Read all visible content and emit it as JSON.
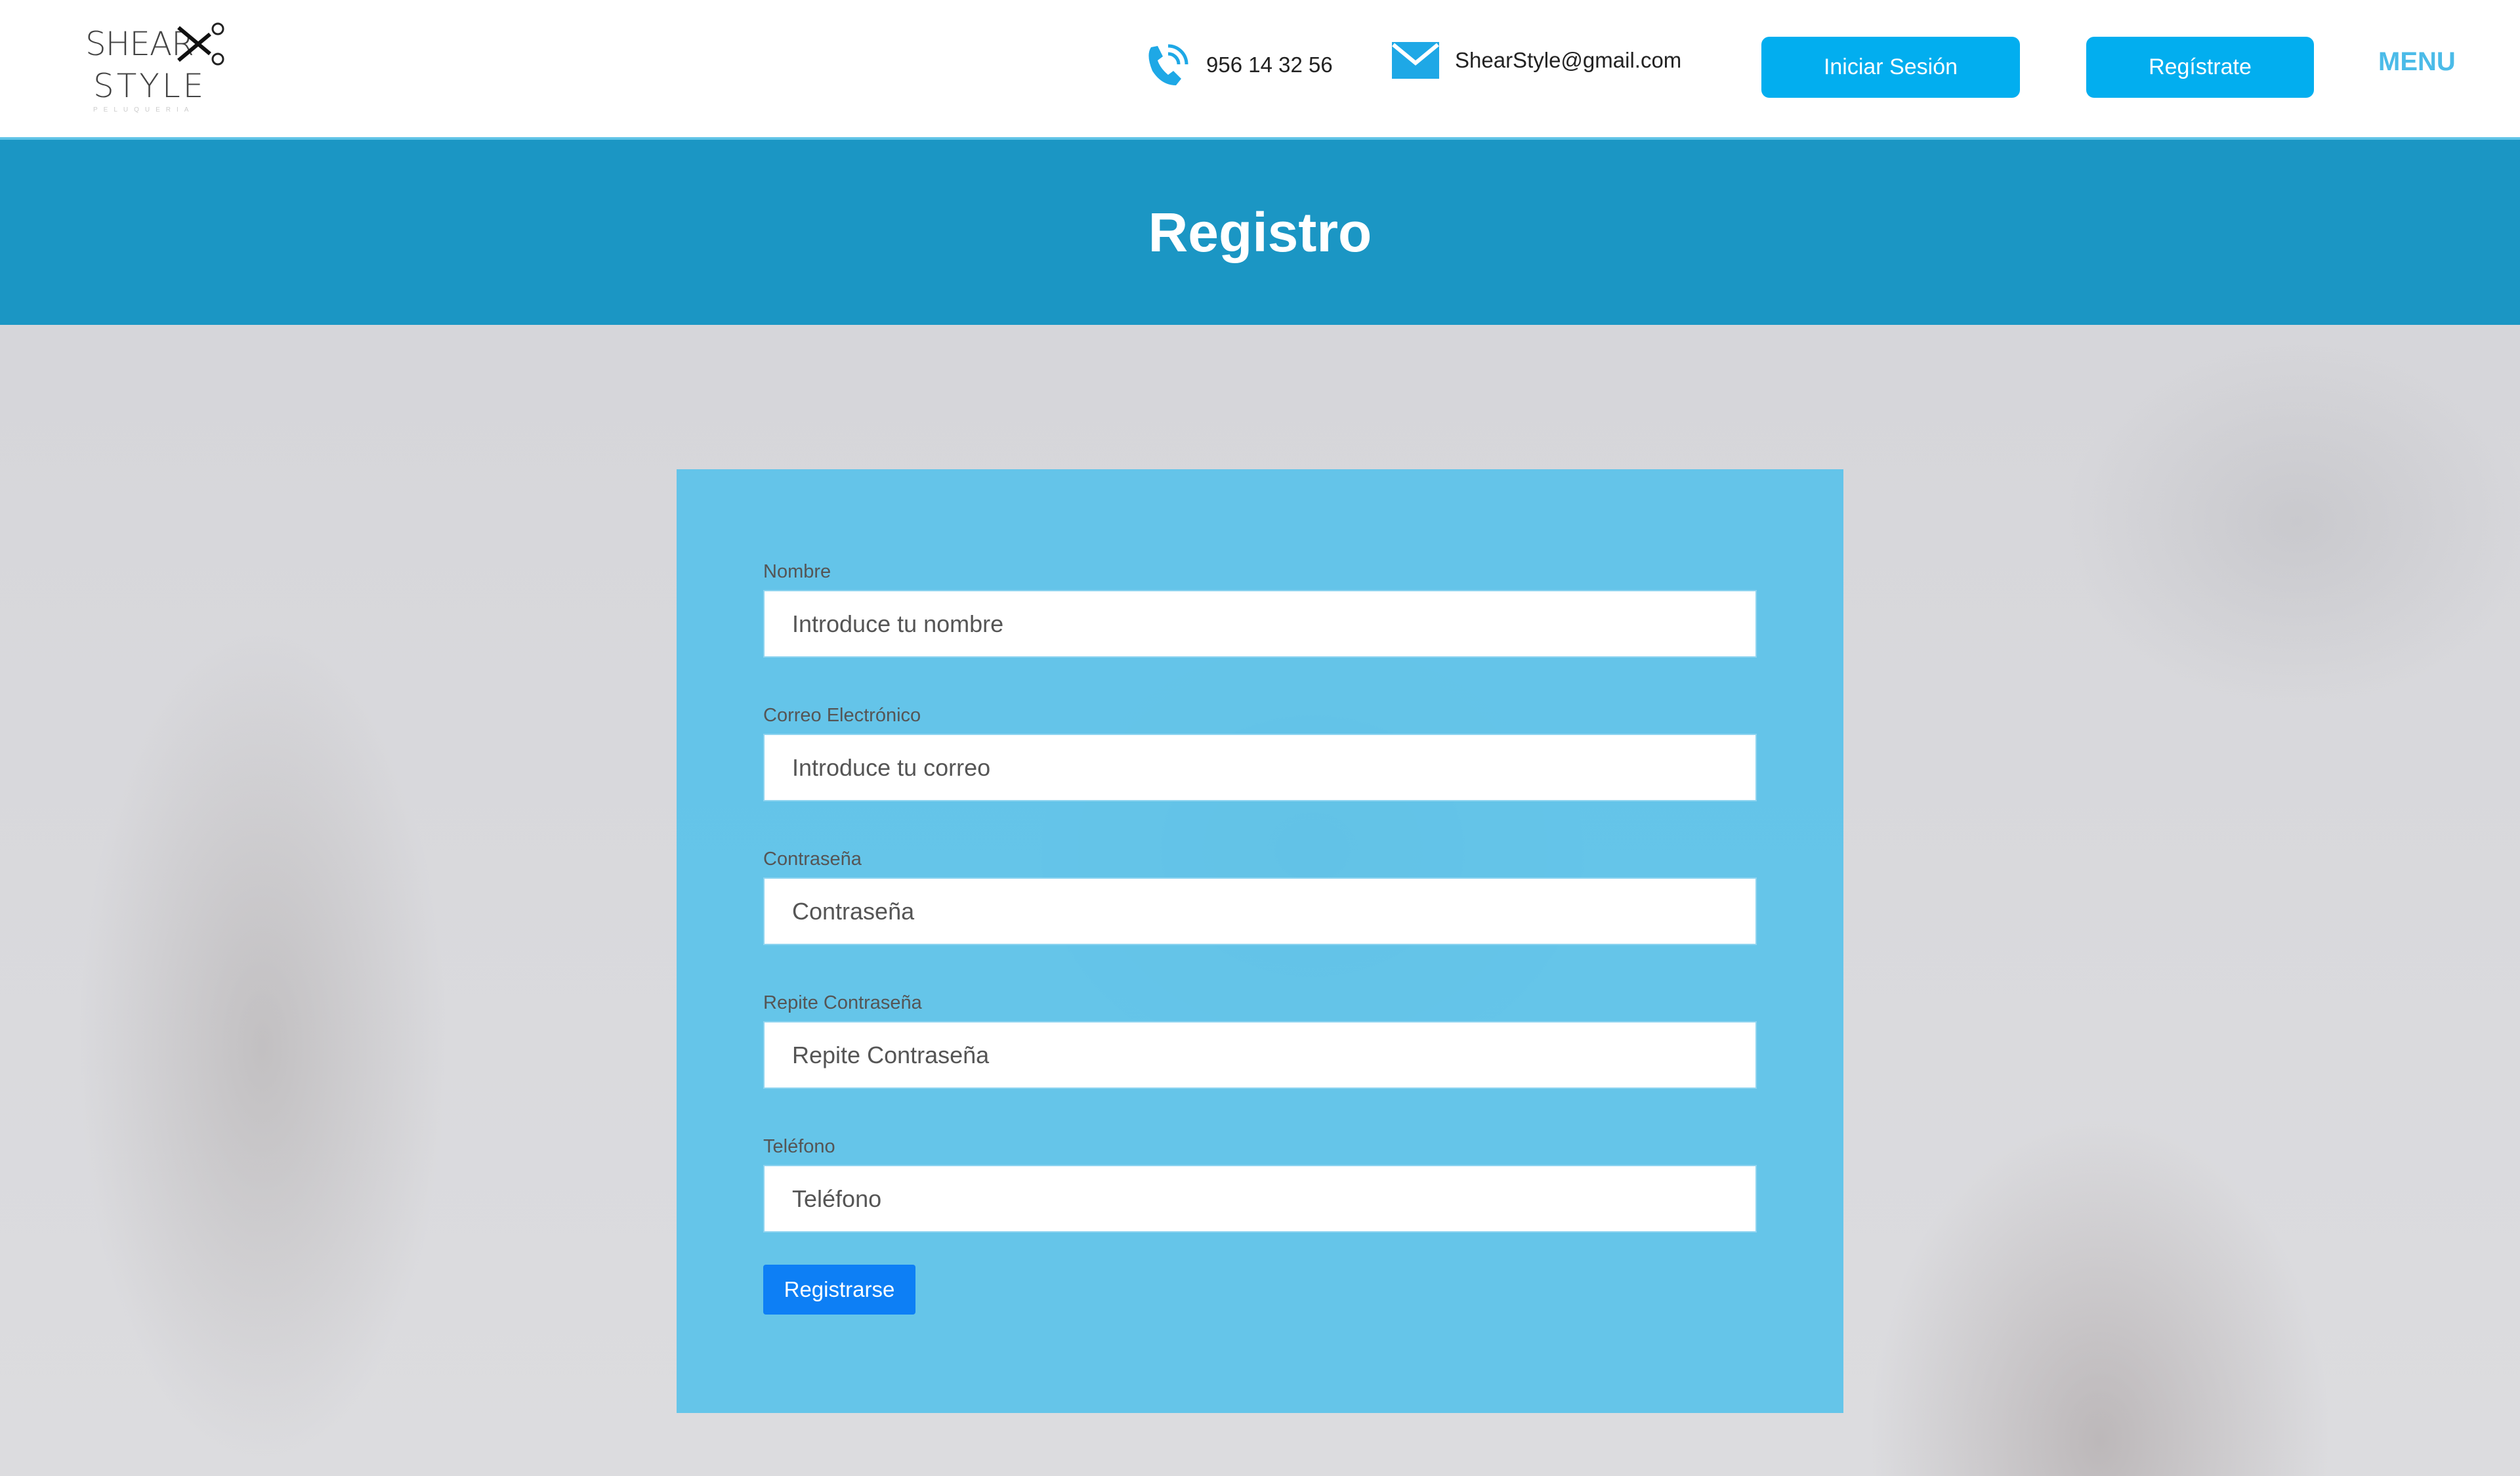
{
  "header": {
    "logo": {
      "line1": "SHEAR",
      "line2": "STYLE",
      "tagline": "PELUQUERIA"
    },
    "phone": "956 14 32 56",
    "email": "ShearStyle@gmail.com",
    "login_label": "Iniciar Sesión",
    "register_label": "Regístrate",
    "menu_label": "MENU"
  },
  "banner": {
    "title": "Registro"
  },
  "form": {
    "fields": [
      {
        "label": "Nombre",
        "placeholder": "Introduce tu nombre"
      },
      {
        "label": "Correo Electrónico",
        "placeholder": "Introduce tu correo"
      },
      {
        "label": "Contraseña",
        "placeholder": "Contraseña"
      },
      {
        "label": "Repite Contraseña",
        "placeholder": "Repite Contraseña"
      },
      {
        "label": "Teléfono",
        "placeholder": "Teléfono"
      }
    ],
    "submit_label": "Registrarse"
  },
  "colors": {
    "accent": "#02aeef",
    "banner": "#1b96c4",
    "panel": "#62c4e8",
    "submit": "#0d7ff5"
  }
}
